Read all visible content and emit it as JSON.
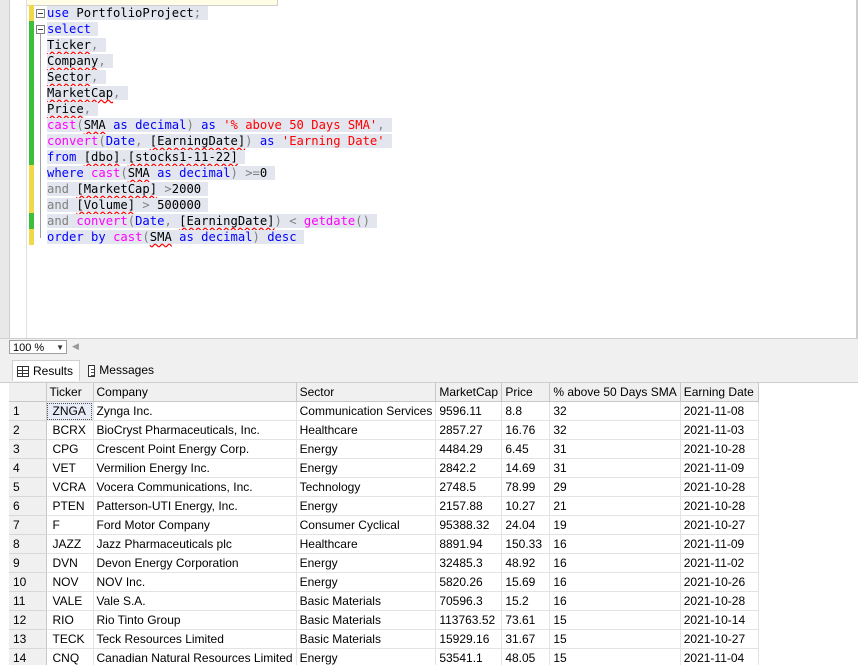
{
  "editor": {
    "lines": [
      {
        "parts": [
          {
            "t": "use",
            "c": "kw"
          },
          {
            "t": " "
          },
          {
            "t": "PortfolioProject",
            "c": "",
            "sq": false
          },
          {
            "t": ";",
            "c": "gr"
          }
        ]
      },
      {
        "parts": [
          {
            "t": "select",
            "c": "kw"
          }
        ]
      },
      {
        "parts": [
          {
            "t": "Ticker",
            "sq": true
          },
          {
            "t": ",",
            "c": "gr"
          }
        ]
      },
      {
        "parts": [
          {
            "t": "Company",
            "sq": true
          },
          {
            "t": ",",
            "c": "gr"
          }
        ]
      },
      {
        "parts": [
          {
            "t": "Sector",
            "sq": true
          },
          {
            "t": ",",
            "c": "gr"
          }
        ]
      },
      {
        "parts": [
          {
            "t": "MarketCap",
            "sq": true
          },
          {
            "t": ",",
            "c": "gr"
          }
        ]
      },
      {
        "parts": [
          {
            "t": "Price",
            "sq": true
          },
          {
            "t": ",",
            "c": "gr"
          }
        ]
      },
      {
        "parts": [
          {
            "t": "cast",
            "c": "fn"
          },
          {
            "t": "(",
            "c": "gr"
          },
          {
            "t": "SMA",
            "sq": true
          },
          {
            "t": " "
          },
          {
            "t": "as",
            "c": "kw"
          },
          {
            "t": " "
          },
          {
            "t": "decimal",
            "c": "kw"
          },
          {
            "t": ")",
            "c": "gr"
          },
          {
            "t": " "
          },
          {
            "t": "as",
            "c": "kw"
          },
          {
            "t": " "
          },
          {
            "t": "'% above 50 Days SMA'",
            "c": "str"
          },
          {
            "t": ",",
            "c": "gr"
          }
        ]
      },
      {
        "parts": [
          {
            "t": "convert",
            "c": "fn"
          },
          {
            "t": "(",
            "c": "gr"
          },
          {
            "t": "Date",
            "c": "kw"
          },
          {
            "t": ",",
            "c": "gr"
          },
          {
            "t": " "
          },
          {
            "t": "[EarningDate]",
            "sq": true
          },
          {
            "t": ")",
            "c": "gr"
          },
          {
            "t": " "
          },
          {
            "t": "as",
            "c": "kw"
          },
          {
            "t": " "
          },
          {
            "t": "'Earning Date'",
            "c": "str"
          }
        ]
      },
      {
        "parts": [
          {
            "t": "from",
            "c": "kw"
          },
          {
            "t": " "
          },
          {
            "t": "[dbo]",
            "sq": true
          },
          {
            "t": ".",
            "c": "gr"
          },
          {
            "t": "[stocks1-11-22]",
            "sq": true
          }
        ]
      },
      {
        "parts": [
          {
            "t": "where",
            "c": "kw"
          },
          {
            "t": " "
          },
          {
            "t": "cast",
            "c": "fn"
          },
          {
            "t": "(",
            "c": "gr"
          },
          {
            "t": "SMA",
            "sq": true
          },
          {
            "t": " "
          },
          {
            "t": "as",
            "c": "kw"
          },
          {
            "t": " "
          },
          {
            "t": "decimal",
            "c": "kw"
          },
          {
            "t": ")",
            "c": "gr"
          },
          {
            "t": " "
          },
          {
            "t": ">=",
            "c": "gr"
          },
          {
            "t": "0"
          }
        ]
      },
      {
        "parts": [
          {
            "t": "and",
            "c": "gr"
          },
          {
            "t": " "
          },
          {
            "t": "[MarketCap]",
            "sq": true
          },
          {
            "t": " "
          },
          {
            "t": ">",
            "c": "gr"
          },
          {
            "t": "2000"
          }
        ]
      },
      {
        "parts": [
          {
            "t": "and",
            "c": "gr"
          },
          {
            "t": " "
          },
          {
            "t": "[Volume]",
            "sq": true
          },
          {
            "t": " "
          },
          {
            "t": ">",
            "c": "gr"
          },
          {
            "t": " "
          },
          {
            "t": "500000"
          }
        ]
      },
      {
        "parts": [
          {
            "t": "and",
            "c": "gr"
          },
          {
            "t": " "
          },
          {
            "t": "convert",
            "c": "fn"
          },
          {
            "t": "(",
            "c": "gr"
          },
          {
            "t": "Date",
            "c": "kw"
          },
          {
            "t": ",",
            "c": "gr"
          },
          {
            "t": " "
          },
          {
            "t": "[EarningDate]",
            "sq": true
          },
          {
            "t": ")",
            "c": "gr"
          },
          {
            "t": " "
          },
          {
            "t": "<",
            "c": "gr"
          },
          {
            "t": " "
          },
          {
            "t": "getdate",
            "c": "fn"
          },
          {
            "t": "()",
            "c": "gr"
          }
        ]
      },
      {
        "parts": [
          {
            "t": "order",
            "c": "kw"
          },
          {
            "t": " "
          },
          {
            "t": "by",
            "c": "kw"
          },
          {
            "t": " "
          },
          {
            "t": "cast",
            "c": "fn"
          },
          {
            "t": "(",
            "c": "gr"
          },
          {
            "t": "SMA",
            "sq": true
          },
          {
            "t": " "
          },
          {
            "t": "as",
            "c": "kw"
          },
          {
            "t": " "
          },
          {
            "t": "decimal",
            "c": "kw"
          },
          {
            "t": ")",
            "c": "gr"
          },
          {
            "t": " "
          },
          {
            "t": "desc",
            "c": "kw"
          }
        ]
      }
    ],
    "change_markers": [
      "yellow",
      "green",
      "green",
      "green",
      "green",
      "green",
      "green",
      "green",
      "green",
      "green",
      "yellow",
      "yellow",
      "yellow",
      "green",
      "yellow"
    ]
  },
  "zoom": {
    "value": "100 %"
  },
  "tabs": {
    "results": "Results",
    "messages": "Messages"
  },
  "grid": {
    "columns": [
      "Ticker",
      "Company",
      "Sector",
      "MarketCap",
      "Price",
      "% above 50 Days SMA",
      "Earning Date"
    ],
    "rows": [
      [
        "1",
        "ZNGA",
        "Zynga Inc.",
        "Communication Services",
        "9596.11",
        "8.8",
        "32",
        "2021-11-08"
      ],
      [
        "2",
        "BCRX",
        "BioCryst Pharmaceuticals, Inc.",
        "Healthcare",
        "2857.27",
        "16.76",
        "32",
        "2021-11-03"
      ],
      [
        "3",
        "CPG",
        "Crescent Point Energy Corp.",
        "Energy",
        "4484.29",
        "6.45",
        "31",
        "2021-10-28"
      ],
      [
        "4",
        "VET",
        "Vermilion Energy Inc.",
        "Energy",
        "2842.2",
        "14.69",
        "31",
        "2021-11-09"
      ],
      [
        "5",
        "VCRA",
        "Vocera Communications, Inc.",
        "Technology",
        "2748.5",
        "78.99",
        "29",
        "2021-10-28"
      ],
      [
        "6",
        "PTEN",
        "Patterson-UTI Energy, Inc.",
        "Energy",
        "2157.88",
        "10.27",
        "21",
        "2021-10-28"
      ],
      [
        "7",
        "F",
        "Ford Motor Company",
        "Consumer Cyclical",
        "95388.32",
        "24.04",
        "19",
        "2021-10-27"
      ],
      [
        "8",
        "JAZZ",
        "Jazz Pharmaceuticals plc",
        "Healthcare",
        "8891.94",
        "150.33",
        "16",
        "2021-11-09"
      ],
      [
        "9",
        "DVN",
        "Devon Energy Corporation",
        "Energy",
        "32485.3",
        "48.92",
        "16",
        "2021-11-02"
      ],
      [
        "10",
        "NOV",
        "NOV Inc.",
        "Energy",
        "5820.26",
        "15.69",
        "16",
        "2021-10-26"
      ],
      [
        "11",
        "VALE",
        "Vale S.A.",
        "Basic Materials",
        "70596.3",
        "15.2",
        "16",
        "2021-10-28"
      ],
      [
        "12",
        "RIO",
        "Rio Tinto Group",
        "Basic Materials",
        "113763.52",
        "73.61",
        "15",
        "2021-10-14"
      ],
      [
        "13",
        "TECK",
        "Teck Resources Limited",
        "Basic Materials",
        "15929.16",
        "31.67",
        "15",
        "2021-10-27"
      ],
      [
        "14",
        "CNQ",
        "Canadian Natural Resources Limited",
        "Energy",
        "53541.1",
        "48.05",
        "15",
        "2021-11-04"
      ]
    ]
  }
}
